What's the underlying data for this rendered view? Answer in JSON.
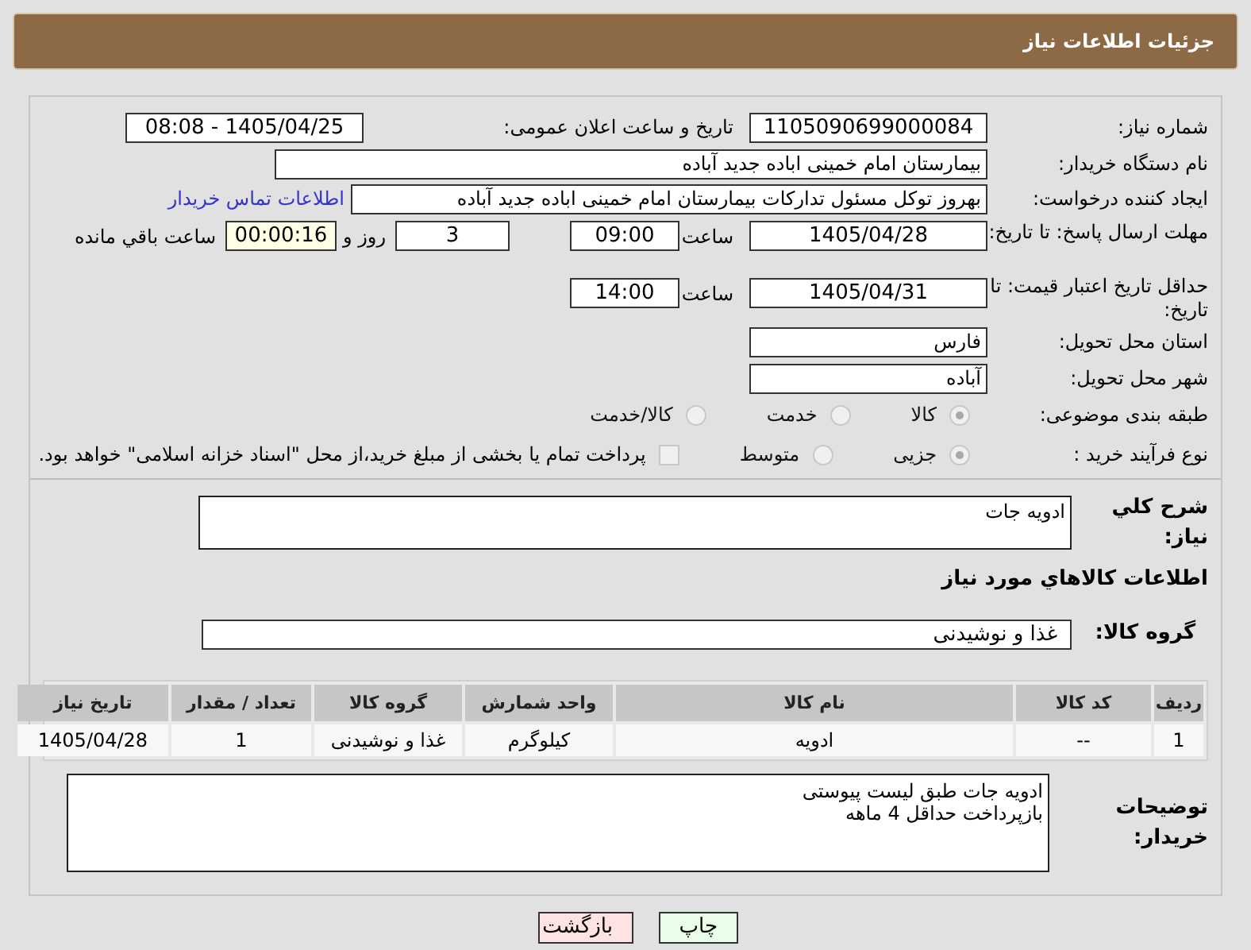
{
  "header": {
    "title": "جزئیات اطلاعات نیاز"
  },
  "need_number": {
    "label": "شماره نیاز:",
    "value": "1105090699000084"
  },
  "announce": {
    "label": "تاریخ و ساعت اعلان عمومی:",
    "value": "1405/04/25 - 08:08"
  },
  "buyer_org": {
    "label": "نام دستگاه خریدار:",
    "value": "بیمارستان امام خمینی اباده جدید آباده"
  },
  "requester": {
    "label": "ایجاد کننده درخواست:",
    "value": "بهروز توکل مسئول تدارکات بیمارستان امام خمینی اباده جدید آباده",
    "link": "اطلاعات تماس خریدار"
  },
  "deadline": {
    "label": "مهلت ارسال پاسخ: تا تاریخ:",
    "date": "1405/04/28",
    "time_label": "ساعت",
    "time": "09:00",
    "days": "3",
    "days_label": "روز و",
    "remaining": "00:00:16",
    "remaining_label": "ساعت باقي مانده"
  },
  "validity": {
    "label": "حداقل تاریخ اعتبار قیمت: تا تاریخ:",
    "date": "1405/04/31",
    "time_label": "ساعت",
    "time": "14:00"
  },
  "province": {
    "label": "استان محل تحویل:",
    "value": "فارس"
  },
  "city": {
    "label": "شهر محل تحویل:",
    "value": "آباده"
  },
  "category": {
    "label": "طبقه بندی موضوعی:",
    "options": [
      {
        "label": "کالا",
        "selected": true
      },
      {
        "label": "خدمت",
        "selected": false
      },
      {
        "label": "کالا/خدمت",
        "selected": false
      }
    ]
  },
  "process": {
    "label": "نوع فرآیند خرید :",
    "options": [
      {
        "label": "جزیی",
        "selected": true
      },
      {
        "label": "متوسط",
        "selected": false
      }
    ],
    "treasury": {
      "checked": false,
      "label": "پرداخت تمام یا بخشی از مبلغ خرید،از محل \"اسناد خزانه اسلامی\" خواهد بود."
    }
  },
  "description": {
    "label": "شرح كلي نياز:",
    "value": "ادویه جات"
  },
  "items_heading": "اطلاعات كالاهاي مورد نياز",
  "goods_group": {
    "label": "گروه کالا:",
    "value": "غذا و نوشیدنی"
  },
  "table": {
    "columns": [
      "ردیف",
      "کد کالا",
      "نام کالا",
      "واحد شمارش",
      "گروه کالا",
      "تعداد / مقدار",
      "تاریخ نیاز"
    ],
    "rows": [
      [
        "1",
        "--",
        "ادویه",
        "کیلوگرم",
        "غذا و نوشیدنی",
        "1",
        "1405/04/28"
      ]
    ]
  },
  "buyer_notes": {
    "label": "توضیحات خریدار:",
    "lines": [
      "ادویه جات طبق لیست پیوستی",
      "بازپرداخت حداقل 4 ماهه"
    ]
  },
  "buttons": [
    {
      "label": "چاپ",
      "kind": "print"
    },
    {
      "label": "بازگشت",
      "kind": "back"
    }
  ]
}
